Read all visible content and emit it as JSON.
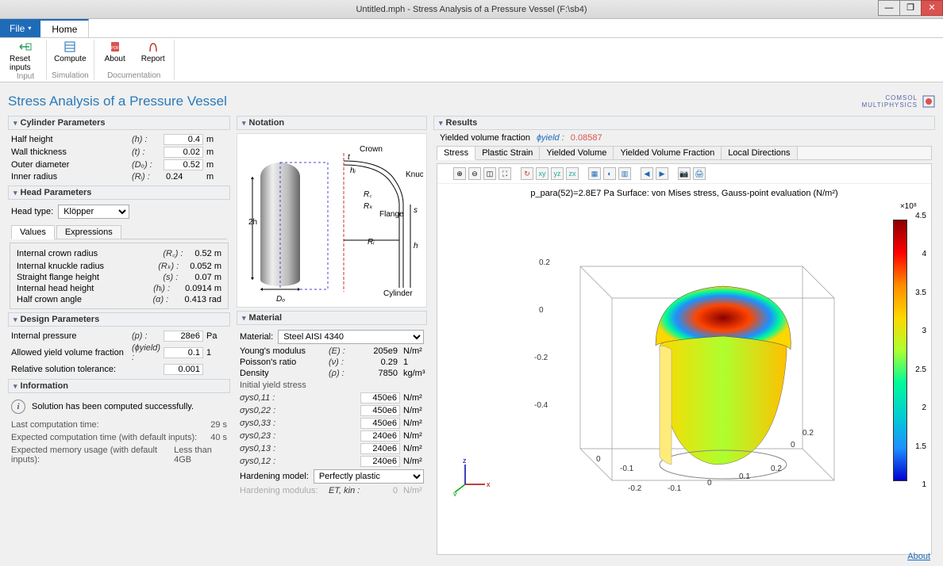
{
  "window": {
    "title": "Untitled.mph - Stress Analysis of a Pressure Vessel (F:\\sb4)"
  },
  "menu": {
    "file": "File",
    "home": "Home"
  },
  "ribbon": {
    "reset": "Reset inputs",
    "compute": "Compute",
    "about": "About",
    "report": "Report",
    "group_input": "Input",
    "group_sim": "Simulation",
    "group_doc": "Documentation"
  },
  "page": {
    "title": "Stress Analysis of a Pressure Vessel",
    "brand1": "COMSOL",
    "brand2": "MULTIPHYSICS"
  },
  "cylinder": {
    "header": "Cylinder Parameters",
    "half_height_lbl": "Half height",
    "half_height_sym": "(h) :",
    "half_height_val": "0.4",
    "half_height_unit": "m",
    "wall_lbl": "Wall thickness",
    "wall_sym": "(t) :",
    "wall_val": "0.02",
    "wall_unit": "m",
    "od_lbl": "Outer diameter",
    "od_sym": "(Dₒ) :",
    "od_val": "0.52",
    "od_unit": "m",
    "ir_lbl": "Inner radius",
    "ir_sym": "(Rᵢ) :",
    "ir_val": "0.24",
    "ir_unit": "m"
  },
  "head": {
    "header": "Head Parameters",
    "type_lbl": "Head type:",
    "type_val": "Klöpper",
    "tab_values": "Values",
    "tab_expr": "Expressions",
    "icr_lbl": "Internal crown radius",
    "icr_sym": "(R꜀) :",
    "icr_val": "0.52 m",
    "ikr_lbl": "Internal knuckle radius",
    "ikr_sym": "(Rₖ) :",
    "ikr_val": "0.052 m",
    "sfh_lbl": "Straight flange height",
    "sfh_sym": "(s) :",
    "sfh_val": "0.07 m",
    "ihh_lbl": "Internal head height",
    "ihh_sym": "(hᵢ) :",
    "ihh_val": "0.0914 m",
    "hca_lbl": "Half crown angle",
    "hca_sym": "(α) :",
    "hca_val": "0.413 rad"
  },
  "design": {
    "header": "Design Parameters",
    "ip_lbl": "Internal pressure",
    "ip_sym": "(p) :",
    "ip_val": "28e6",
    "ip_unit": "Pa",
    "yf_lbl": "Allowed yield volume fraction",
    "yf_sym": "(ϕyield) :",
    "yf_val": "0.1",
    "yf_unit": "1",
    "rt_lbl": "Relative solution tolerance:",
    "rt_val": "0.001"
  },
  "info": {
    "header": "Information",
    "msg": "Solution has been computed successfully.",
    "lct_lbl": "Last computation time:",
    "lct_val": "29 s",
    "ect_lbl": "Expected computation time (with default inputs):",
    "ect_val": "40 s",
    "emu_lbl": "Expected memory usage (with default inputs):",
    "emu_val": "Less than 4GB"
  },
  "notation": {
    "header": "Notation",
    "crown": "Crown",
    "knuckle": "Knuckle",
    "flange": "Flange",
    "cylinder": "Cylinder",
    "dims": {
      "rc": "R꜀",
      "rk": "Rₖ",
      "ri": "Rᵢ",
      "de": "Dₒ",
      "h2": "2h",
      "hi": "hᵢ",
      "h": "h",
      "t": "t",
      "s": "s"
    }
  },
  "material": {
    "header": "Material",
    "mat_lbl": "Material:",
    "mat_val": "Steel AISI 4340",
    "ym_lbl": "Young's modulus",
    "ym_sym": "(E) :",
    "ym_val": "205e9",
    "ym_unit": "N/m²",
    "pr_lbl": "Poisson's ratio",
    "pr_sym": "(ν) :",
    "pr_val": "0.29",
    "pr_unit": "1",
    "den_lbl": "Density",
    "den_sym": "(ρ) :",
    "den_val": "7850",
    "den_unit": "kg/m³",
    "iys_lbl": "Initial yield stress",
    "s011_lbl": "σys0,11 :",
    "s011_val": "450e6",
    "s022_lbl": "σys0,22 :",
    "s022_val": "450e6",
    "s033_lbl": "σys0,33 :",
    "s033_val": "450e6",
    "s023_lbl": "σys0,23 :",
    "s023_val": "240e6",
    "s013_lbl": "σys0,13 :",
    "s013_val": "240e6",
    "s012_lbl": "σys0,12 :",
    "s012_val": "240e6",
    "stress_unit": "N/m²",
    "hm_lbl": "Hardening model:",
    "hm_val": "Perfectly plastic",
    "hmod_lbl": "Hardening modulus:",
    "hmod_sym": "ET, kin :",
    "hmod_val": "0",
    "hmod_unit": "N/m²"
  },
  "results": {
    "header": "Results",
    "yvf_lbl": "Yielded volume fraction",
    "yvf_sym": "ϕyield :",
    "yvf_val": "0.08587",
    "tabs": [
      "Stress",
      "Plastic Strain",
      "Yielded Volume",
      "Yielded Volume Fraction",
      "Local Directions"
    ],
    "plot_title": "p_para(52)=2.8E7 Pa   Surface: von Mises stress, Gauss-point evaluation (N/m²)"
  },
  "chart_data": {
    "type": "3d-surface-colormap",
    "title": "p_para(52)=2.8E7 Pa   Surface: von Mises stress, Gauss-point evaluation (N/m²)",
    "x_range": [
      -0.2,
      0.2
    ],
    "y_range": [
      -0.2,
      0.2
    ],
    "z_range": [
      -0.4,
      0.2
    ],
    "x_ticks": [
      -0.2,
      -0.1,
      0,
      0.1,
      0.2
    ],
    "y_ticks": [
      -0.2,
      -0.1,
      0,
      0.1,
      0.2
    ],
    "z_ticks": [
      -0.4,
      -0.2,
      0,
      0.2
    ],
    "colorbar": {
      "exponent": "×10⁸",
      "min": 1.0,
      "max": 4.5,
      "ticks": [
        1,
        1.5,
        2,
        2.5,
        3,
        3.5,
        4,
        4.5
      ],
      "unit": "N/m²"
    },
    "description": "Cutaway von Mises stress on pressure-vessel head and cylinder; peak (red ~4.5e8) at knuckle region, cylinder body ~2.5–3e8 (yellow-green), lowest (blue ~1e8) in thin bands near crown/knuckle interface."
  },
  "footer": {
    "about": "About"
  }
}
